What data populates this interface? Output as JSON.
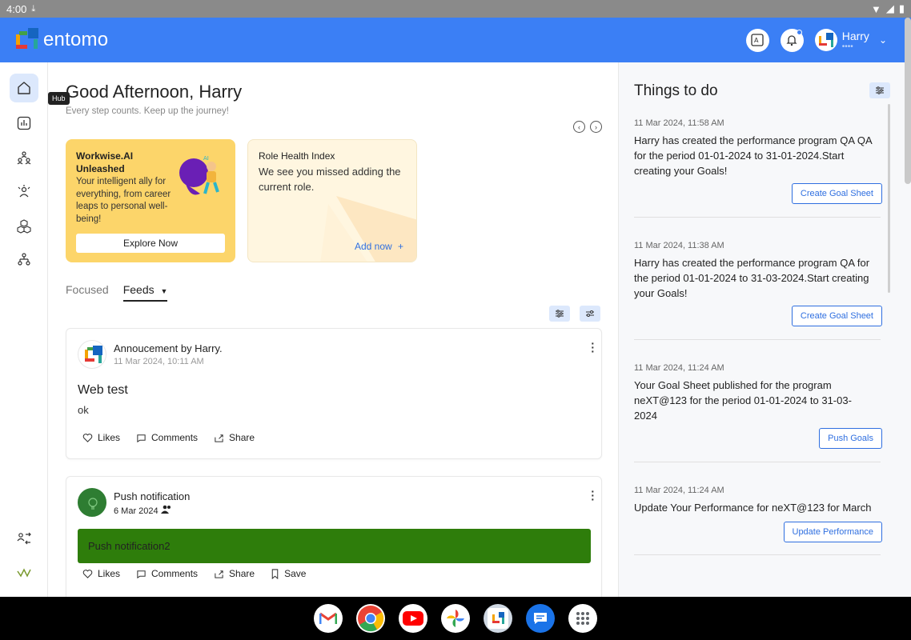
{
  "status_bar": {
    "time": "4:00"
  },
  "header": {
    "app_name": "entomo",
    "user": {
      "name": "Harry",
      "subtitle": "••••"
    }
  },
  "sidebar": {
    "tooltip": "Hub",
    "items": [
      {
        "icon": "home-icon"
      },
      {
        "icon": "chart-icon"
      },
      {
        "icon": "team-icon"
      },
      {
        "icon": "person-target-icon"
      },
      {
        "icon": "cubes-icon"
      },
      {
        "icon": "org-icon"
      },
      {
        "icon": "switch-user-icon"
      },
      {
        "icon": "pulse-icon"
      }
    ]
  },
  "main": {
    "greeting": "Good Afternoon, Harry",
    "subtitle": "Every step counts. Keep up the journey!",
    "cards": [
      {
        "title": "Workwise.AI Unleashed",
        "description": "Your intelligent ally for everything, from career leaps to personal well-being!",
        "button": "Explore Now"
      },
      {
        "title": "Role Health Index",
        "description": "We see you missed adding the current role.",
        "link": "Add now"
      }
    ],
    "tabs": [
      {
        "label": "Focused"
      },
      {
        "label": "Feeds"
      }
    ],
    "posts": [
      {
        "title": "Annoucement by Harry.",
        "date": "11 Mar 2024, 10:11 AM",
        "heading": "Web test",
        "body": "ok",
        "actions": [
          "Likes",
          "Comments",
          "Share"
        ]
      },
      {
        "title": "Push notification",
        "date": "6 Mar 2024",
        "banner": "Push notification2",
        "actions": [
          "Likes",
          "Comments",
          "Share",
          "Save"
        ]
      }
    ]
  },
  "right_pane": {
    "title": "Things to do",
    "items": [
      {
        "date": "11 Mar 2024, 11:58 AM",
        "text": "Harry has created the performance program QA QA for the period 01-01-2024 to 31-01-2024.Start creating your Goals!",
        "button": "Create Goal Sheet"
      },
      {
        "date": "11 Mar 2024, 11:38 AM",
        "text": "Harry has created the performance program QA for the period 01-01-2024 to 31-03-2024.Start creating your Goals!",
        "button": "Create Goal Sheet"
      },
      {
        "date": "11 Mar 2024, 11:24 AM",
        "text": "Your Goal Sheet published for the program neXT@123 for the period 01-01-2024 to 31-03-2024",
        "button": "Push Goals"
      },
      {
        "date": "11 Mar 2024, 11:24 AM",
        "text": "Update Your Performance for neXT@123 for March",
        "button": "Update Performance"
      }
    ]
  },
  "dock": {
    "apps": [
      "Gmail",
      "Chrome",
      "YouTube",
      "Photos",
      "entomo",
      "Messages",
      "App drawer"
    ]
  }
}
